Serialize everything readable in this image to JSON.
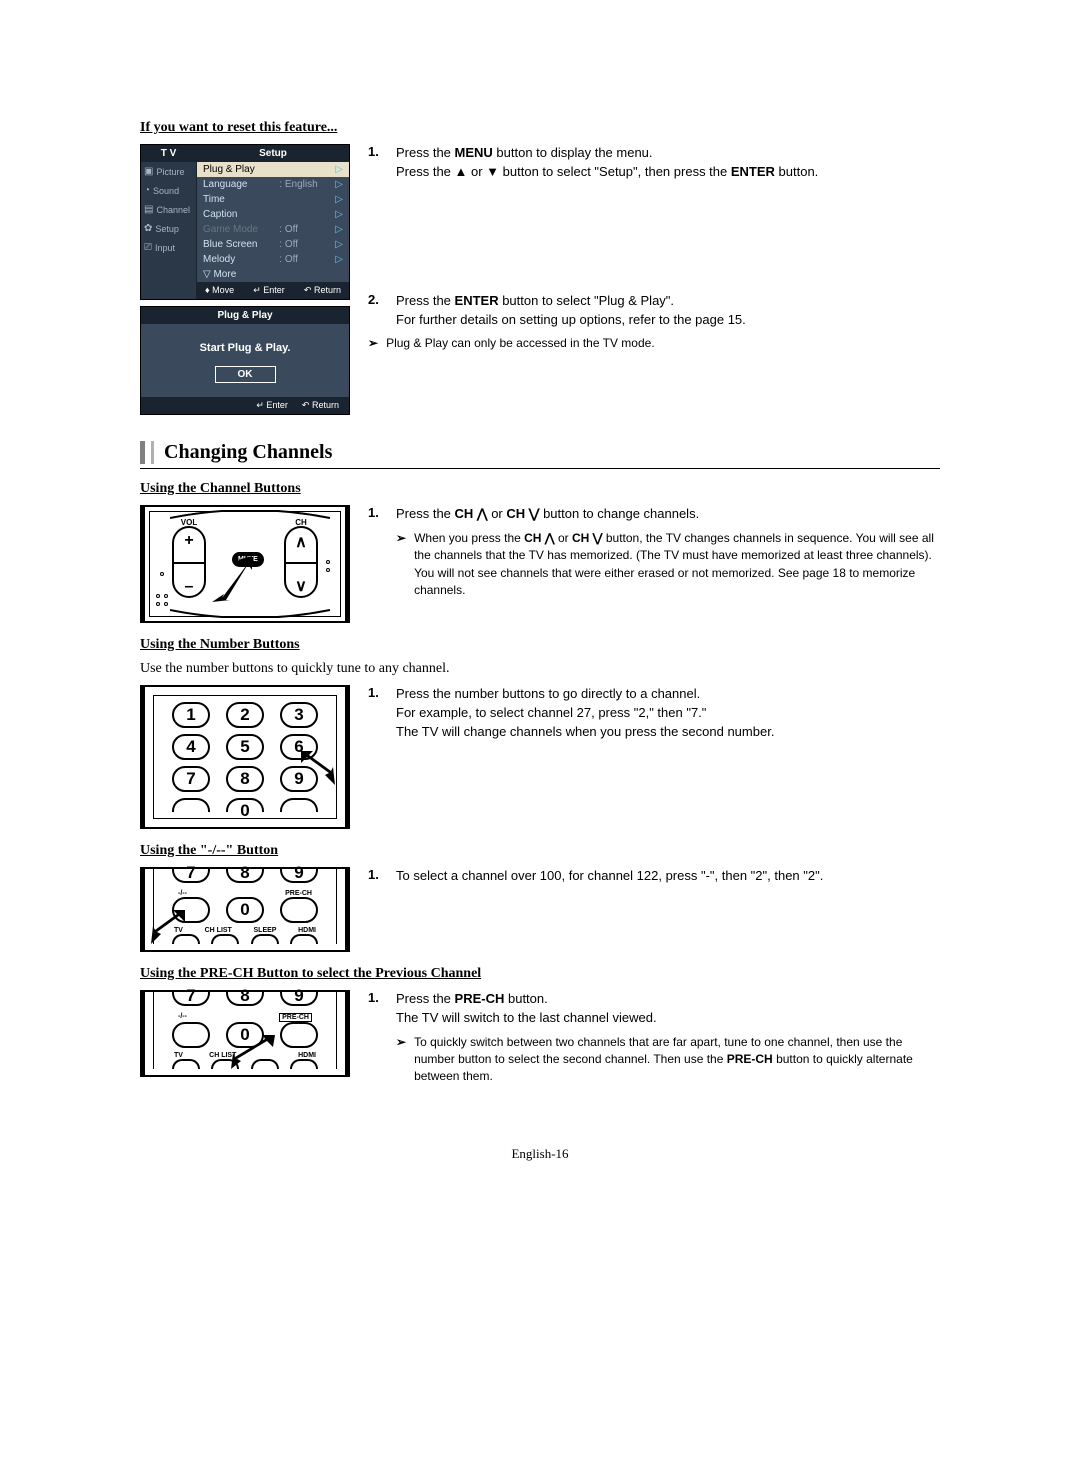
{
  "reset": {
    "heading": "If you want to reset this feature...",
    "step1a": "Press the MENU button to display the menu.",
    "step1b": "Press the ▲ or ▼ button to select \"Setup\", then press the ENTER button.",
    "step2a": "Press the ENTER button to select \"Plug & Play\".",
    "step2b": "For further details on setting up options, refer to the page 15.",
    "note": "Plug & Play can only be accessed in the TV mode."
  },
  "osd": {
    "tv": "T V",
    "setup": "Setup",
    "side": {
      "picture": "Picture",
      "sound": "Sound",
      "channel": "Channel",
      "setupLabel": "Setup",
      "input": "Input"
    },
    "rows": {
      "plugplay": "Plug & Play",
      "language": "Language",
      "language_val": ": English",
      "time": "Time",
      "caption": "Caption",
      "gamemode": "Game Mode",
      "gamemode_val": ": Off",
      "bluescreen": "Blue Screen",
      "bluescreen_val": ": Off",
      "melody": "Melody",
      "melody_val": ": Off",
      "more": "▽ More"
    },
    "footer": {
      "move": "Move",
      "enter": "Enter",
      "return": "Return"
    },
    "pnp": {
      "title": "Plug & Play",
      "msg": "Start Plug & Play.",
      "ok": "OK"
    }
  },
  "channels": {
    "title": "Changing Channels",
    "sub1": "Using the Channel Buttons",
    "step1": "Press the CH ⋀ or CH ⋁ button to change channels.",
    "note1": "When you press the CH ⋀ or CH ⋁ button, the TV changes channels in sequence. You will see all the channels that the TV has memorized. (The TV must have memorized at least three channels). You will not see channels that were either erased or not memorized. See page 18 to memorize channels.",
    "sub2": "Using the Number Buttons",
    "intro2": "Use the number buttons to quickly tune to any channel.",
    "step2a": "Press the number buttons to go directly to a channel.",
    "step2b": "For example, to select channel 27, press \"2,\" then \"7.\"",
    "step2c": "The TV will change channels when you press the second number.",
    "sub3": "Using the \"-/--\" Button",
    "step3": "To select a channel over 100, for channel 122, press \"-\", then \"2\", then \"2\".",
    "sub4": "Using the PRE-CH Button to select the Previous Channel",
    "step4a": "Press the PRE-CH button.",
    "step4b": "The TV will switch to the last channel viewed.",
    "note4": "To quickly switch between two channels that are far apart, tune to one channel, then use the number button to select the second channel. Then use the PRE-CH button to quickly alternate between them."
  },
  "remote": {
    "vol": "VOL",
    "ch": "CH",
    "mute": "MUTE",
    "dash": "-/--",
    "prech": "PRE-CH",
    "tv": "TV",
    "chlist": "CH LIST",
    "sleep": "SLEEP",
    "hdmi": "HDMI"
  },
  "nums": {
    "n1": "1",
    "n2": "2",
    "n3": "3",
    "n4": "4",
    "n5": "5",
    "n6": "6",
    "n7": "7",
    "n8": "8",
    "n9": "9",
    "n0": "0"
  },
  "markers": {
    "one": "1.",
    "two": "2.",
    "arrow": "➢",
    "updown": "♦",
    "enterIcon": "↵",
    "returnIcon": "↶"
  },
  "page": "English-16"
}
